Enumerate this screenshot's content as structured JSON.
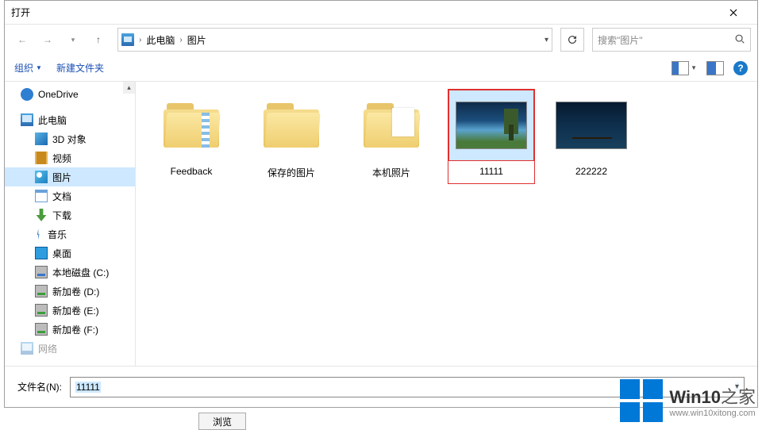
{
  "window": {
    "title": "打开"
  },
  "breadcrumb": {
    "root": "此电脑",
    "current": "图片"
  },
  "search": {
    "placeholder": "搜索\"图片\""
  },
  "toolbar": {
    "organize": "组织",
    "newfolder": "新建文件夹"
  },
  "sidebar": {
    "items": [
      {
        "label": "OneDrive",
        "icon": "i-cloud",
        "lvl": 1
      },
      {
        "label": "此电脑",
        "icon": "i-pc",
        "lvl": 1
      },
      {
        "label": "3D 对象",
        "icon": "i-cube",
        "lvl": 2
      },
      {
        "label": "视频",
        "icon": "i-film",
        "lvl": 2
      },
      {
        "label": "图片",
        "icon": "i-pic",
        "lvl": 2,
        "selected": true
      },
      {
        "label": "文档",
        "icon": "i-doc",
        "lvl": 2
      },
      {
        "label": "下载",
        "icon": "i-down",
        "lvl": 2
      },
      {
        "label": "音乐",
        "icon": "i-note",
        "lvl": 2
      },
      {
        "label": "桌面",
        "icon": "i-desk",
        "lvl": 2
      },
      {
        "label": "本地磁盘 (C:)",
        "icon": "i-drive",
        "lvl": 2
      },
      {
        "label": "新加卷 (D:)",
        "icon": "i-drive grn",
        "lvl": 2
      },
      {
        "label": "新加卷 (E:)",
        "icon": "i-drive grn",
        "lvl": 2
      },
      {
        "label": "新加卷 (F:)",
        "icon": "i-drive grn",
        "lvl": 2
      },
      {
        "label": "网络",
        "icon": "i-pc",
        "lvl": 1,
        "cut": true
      }
    ]
  },
  "files": {
    "items": [
      {
        "name": "Feedback",
        "type": "folder",
        "variant": "strip"
      },
      {
        "name": "保存的图片",
        "type": "folder"
      },
      {
        "name": "本机照片",
        "type": "folder",
        "variant": "paper"
      },
      {
        "name": "11111",
        "type": "image",
        "variant": "tree",
        "selected": true
      },
      {
        "name": "222222",
        "type": "image",
        "variant": "bridge"
      }
    ]
  },
  "filename": {
    "label": "文件名(N):",
    "value": "11111"
  },
  "watermark": {
    "brand_a": "Win10",
    "brand_b": "之家",
    "url": "www.win10xitong.com"
  },
  "stub": {
    "browse": "浏览"
  }
}
